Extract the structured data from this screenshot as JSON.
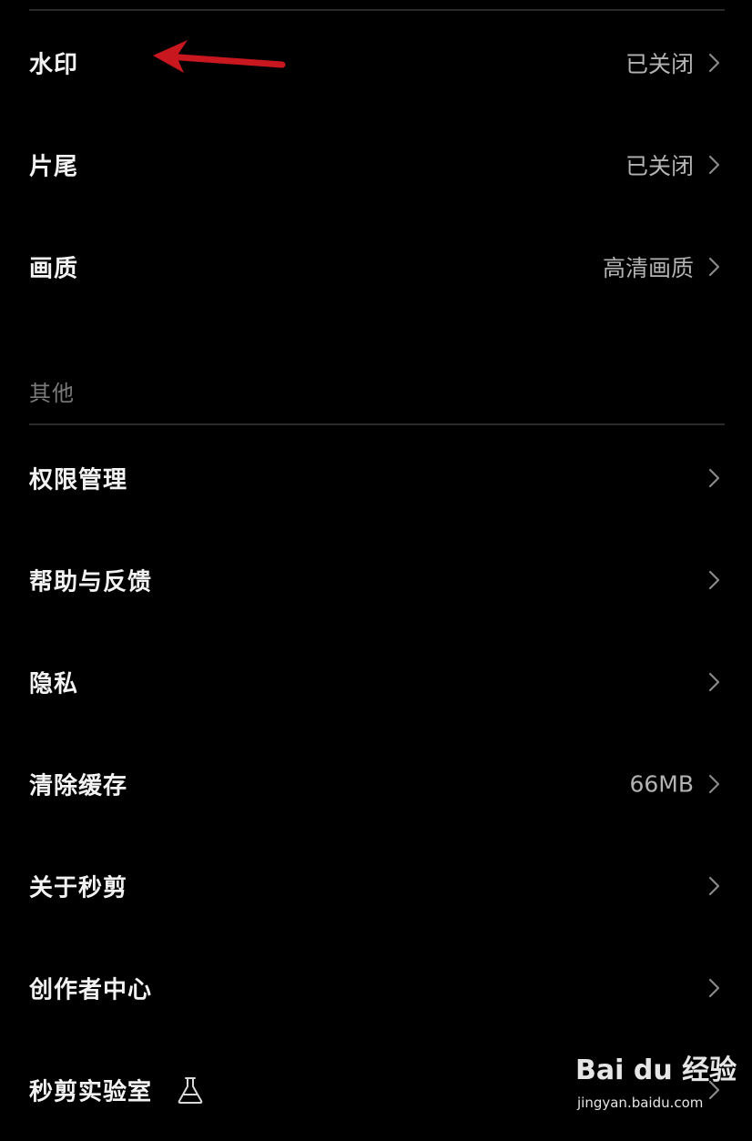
{
  "settings": {
    "items_top": [
      {
        "label": "水印",
        "value": "已关闭"
      },
      {
        "label": "片尾",
        "value": "已关闭"
      },
      {
        "label": "画质",
        "value": "高清画质"
      }
    ],
    "section_other": "其他",
    "items_other": [
      {
        "label": "权限管理",
        "value": ""
      },
      {
        "label": "帮助与反馈",
        "value": ""
      },
      {
        "label": "隐私",
        "value": ""
      },
      {
        "label": "清除缓存",
        "value": "66MB"
      },
      {
        "label": "关于秒剪",
        "value": ""
      },
      {
        "label": "创作者中心",
        "value": ""
      },
      {
        "label": "秒剪实验室",
        "value": ""
      }
    ]
  },
  "watermark": {
    "brand": "Bai du 经验",
    "url": "jingyan.baidu.com"
  },
  "colors": {
    "background": "#000000",
    "label": "#f2f2f2",
    "value": "#b3b3b3",
    "section": "#7a7a7a",
    "divider": "#2a2a2a",
    "annotation_arrow": "#c8171e"
  },
  "icons": {
    "chevron": "chevron-right-icon",
    "lab": "flask-icon",
    "annotation": "red-arrow-annotation"
  }
}
